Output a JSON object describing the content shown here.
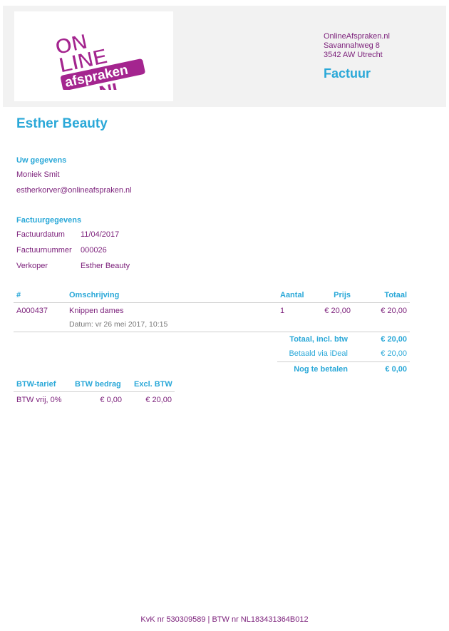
{
  "logo": {
    "line1": "ON",
    "line2": "LINE",
    "line3": "afspraken",
    "line4": ".NL"
  },
  "company": {
    "name": "OnlineAfspraken.nl",
    "street": "Savannahweg 8",
    "city": "3542 AW Utrecht"
  },
  "document_title": "Factuur",
  "brand_name": "Esther Beauty",
  "customer": {
    "section_title": "Uw gegevens",
    "name": "Moniek Smit",
    "email": "estherkorver@onlineafspraken.nl"
  },
  "invoice": {
    "section_title": "Factuurgegevens",
    "date_label": "Factuurdatum",
    "date_value": "11/04/2017",
    "number_label": "Factuurnummer",
    "number_value": "000026",
    "seller_label": "Verkoper",
    "seller_value": "Esther Beauty"
  },
  "items_table": {
    "headers": {
      "code": "#",
      "description": "Omschrijving",
      "quantity": "Aantal",
      "price": "Prijs",
      "total": "Totaal"
    },
    "rows": [
      {
        "code": "A000437",
        "description": "Knippen dames",
        "quantity": "1",
        "price": "€ 20,00",
        "total": "€ 20,00",
        "detail": "Datum: vr 26 mei 2017, 10:15"
      }
    ]
  },
  "totals": {
    "total_label": "Totaal, incl. btw",
    "total_value": "€ 20,00",
    "paid_label": "Betaald via iDeal",
    "paid_value": "€ 20,00",
    "due_label": "Nog te betalen",
    "due_value": "€ 0,00"
  },
  "vat_table": {
    "headers": {
      "rate": "BTW-tarief",
      "amount": "BTW bedrag",
      "excl": "Excl. BTW"
    },
    "rows": [
      {
        "rate": "BTW vrij, 0%",
        "amount": "€ 0,00",
        "excl": "€ 20,00"
      }
    ]
  },
  "footer": "KvK nr 530309589 | BTW nr NL183431364B012",
  "colors": {
    "accent": "#2aa8d8",
    "text": "#7b1f7a",
    "logo_purple": "#a4258f",
    "header_bg": "#f2f2f2"
  }
}
